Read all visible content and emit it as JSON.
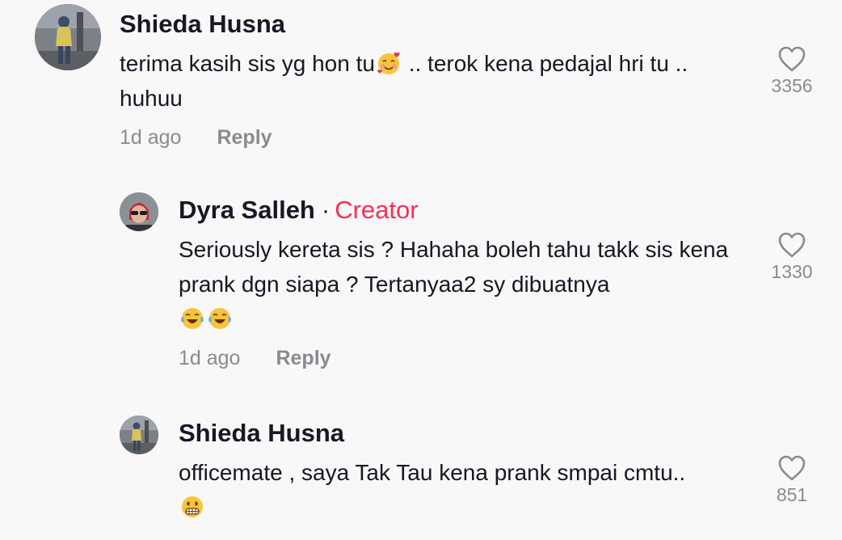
{
  "comments": [
    {
      "username": "Shieda Husna",
      "text_before": "terima kasih sis yg hon tu",
      "text_after": " .. terok kena pedajal hri tu .. huhuu",
      "emoji_icon": "smiling-face-with-hearts",
      "time": "1d ago",
      "reply": "Reply",
      "likes": "3356"
    },
    {
      "username": "Dyra Salleh",
      "separator": "·",
      "badge": "Creator",
      "text": "Seriously kereta sis ? Hahaha boleh tahu takk sis kena prank dgn siapa ? Tertanyaa2 sy dibuatnya",
      "emoji_icon": "face-with-tears-of-joy",
      "time": "1d ago",
      "reply": "Reply",
      "likes": "1330"
    },
    {
      "username": "Shieda Husna",
      "text": "officemate , saya Tak Tau kena prank smpai cmtu..",
      "emoji_icon": "grimacing-face",
      "likes": "851"
    }
  ],
  "colors": {
    "background": "#f8f8f8",
    "text": "#161823",
    "muted": "#8a8b91",
    "creator": "#fe2c55"
  }
}
